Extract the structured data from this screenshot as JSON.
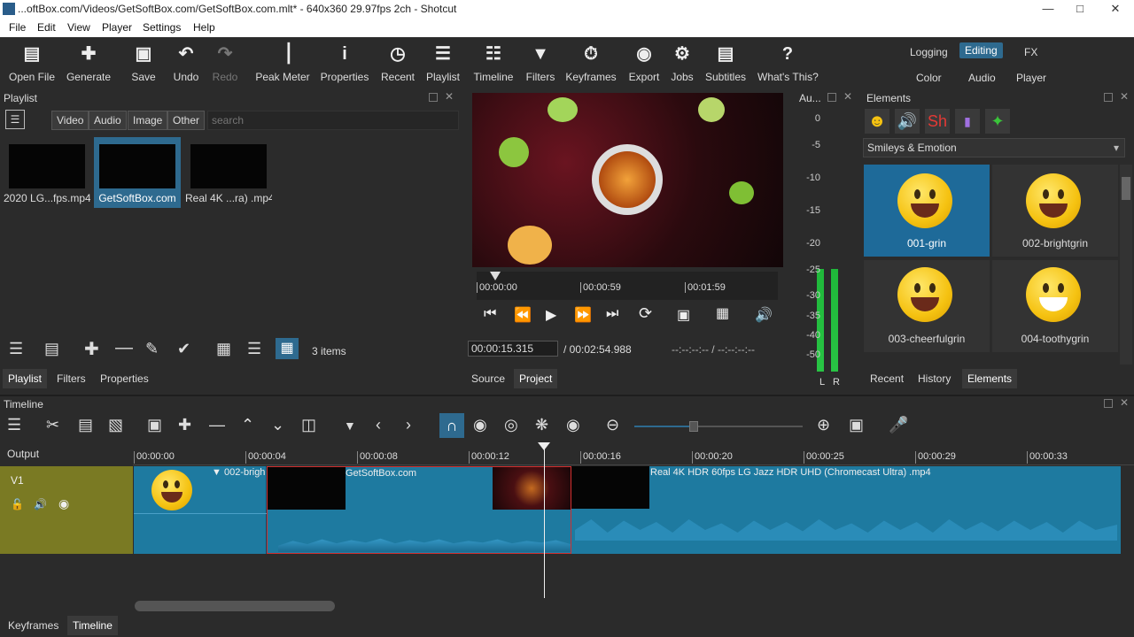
{
  "window": {
    "title": "...oftBox.com/Videos/GetSoftBox.com/GetSoftBox.com.mlt* - 640x360 29.97fps 2ch - Shotcut"
  },
  "menu": [
    "File",
    "Edit",
    "View",
    "Player",
    "Settings",
    "Help"
  ],
  "toolbar": [
    {
      "label": "Open File",
      "icon": "folder-icon"
    },
    {
      "label": "Generate",
      "icon": "generate-icon"
    },
    {
      "label": "Save",
      "icon": "save-icon"
    },
    {
      "label": "Undo",
      "icon": "undo-icon"
    },
    {
      "label": "Redo",
      "icon": "redo-icon",
      "disabled": true
    },
    {
      "label": "Peak Meter",
      "icon": "peak-meter-icon"
    },
    {
      "label": "Properties",
      "icon": "info-icon"
    },
    {
      "label": "Recent",
      "icon": "clock-icon"
    },
    {
      "label": "Playlist",
      "icon": "list-icon"
    },
    {
      "label": "Timeline",
      "icon": "timeline-icon"
    },
    {
      "label": "Filters",
      "icon": "filter-icon"
    },
    {
      "label": "Keyframes",
      "icon": "stopwatch-icon"
    },
    {
      "label": "Export",
      "icon": "export-icon"
    },
    {
      "label": "Jobs",
      "icon": "gear-icon"
    },
    {
      "label": "Subtitles",
      "icon": "subtitles-icon"
    },
    {
      "label": "What's This?",
      "icon": "question-icon"
    }
  ],
  "workspaces": {
    "logging": "Logging",
    "editing": "Editing",
    "fx": "FX",
    "color": "Color",
    "audio": "Audio",
    "player": "Player"
  },
  "playlist": {
    "title": "Playlist",
    "filters": [
      "Video",
      "Audio",
      "Image",
      "Other"
    ],
    "search_placeholder": "search",
    "items": [
      {
        "caption": "2020 LG...fps.mp4"
      },
      {
        "caption": "GetSoftBox.com"
      },
      {
        "caption": "Real 4K ...ra) .mp4"
      }
    ],
    "count": "3 items",
    "tabs": [
      "Playlist",
      "Filters",
      "Properties"
    ]
  },
  "player": {
    "ticks": [
      "00:00:00",
      "00:00:59",
      "00:01:59"
    ],
    "position": "00:00:15.315",
    "duration": "/ 00:02:54.988",
    "inout": "--:--:--:-- / --:--:--:--",
    "tabs": [
      "Source",
      "Project"
    ]
  },
  "audio": {
    "title": "Au...",
    "scale": [
      "0",
      "-5",
      "-10",
      "-15",
      "-20",
      "-25",
      "-30",
      "-35",
      "-40",
      "-50"
    ],
    "l": "L",
    "r": "R"
  },
  "elements": {
    "title": "Elements",
    "category": "Smileys & Emotion",
    "items": [
      "001-grin",
      "002-brightgrin",
      "003-cheerfulgrin",
      "004-toothygrin"
    ],
    "tabs": [
      "Recent",
      "History",
      "Elements"
    ],
    "tab_icon_text": "Sh"
  },
  "timeline": {
    "title": "Timeline",
    "output": "Output",
    "track": "V1",
    "ticks": [
      "00:00:00",
      "00:00:04",
      "00:00:08",
      "00:00:12",
      "00:00:16",
      "00:00:20",
      "00:00:25",
      "00:00:29",
      "00:00:33"
    ],
    "clip1_label": "002-brigh",
    "clip2_label": "GetSoftBox.com",
    "clip3_label": "Real 4K HDR 60fps LG Jazz HDR UHD (Chromecast Ultra) .mp4"
  },
  "bottom_tabs": [
    "Keyframes",
    "Timeline"
  ],
  "colors": {
    "accent": "#2e6a8f",
    "track_header": "#7a7a23",
    "clip": "#1e7aa0",
    "meter": "#1fb83a"
  }
}
